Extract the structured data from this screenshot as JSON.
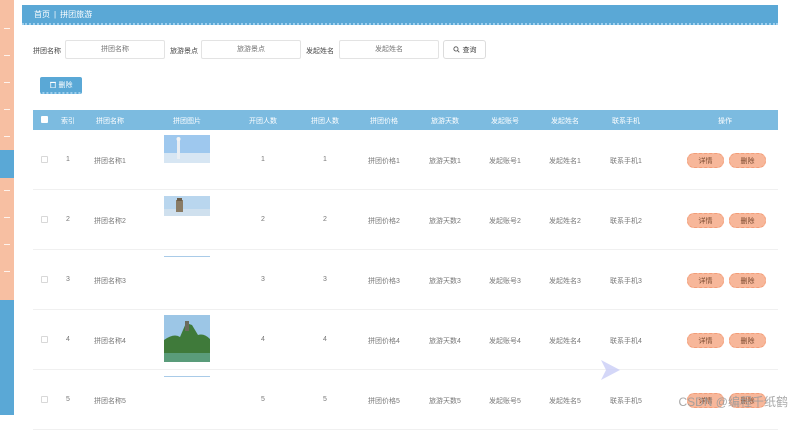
{
  "breadcrumb": {
    "home": "首页",
    "separator": "|",
    "current": "拼团旅游"
  },
  "search": {
    "fields": [
      {
        "label": "拼团名称",
        "placeholder": "拼团名称"
      },
      {
        "label": "旅游景点",
        "placeholder": "旅游景点"
      },
      {
        "label": "发起姓名",
        "placeholder": "发起姓名"
      }
    ],
    "button_label": "查询",
    "button_icon": "search-icon"
  },
  "toolbar": {
    "delete_label": "删除",
    "delete_icon": "trash-icon"
  },
  "table": {
    "columns": [
      "索引",
      "拼团名称",
      "拼团图片",
      "开团人数",
      "拼团人数",
      "拼团价格",
      "旅游天数",
      "发起账号",
      "发起姓名",
      "联系手机",
      "操作"
    ],
    "rows": [
      {
        "index": "1",
        "name": "拼团名称1",
        "open": "1",
        "join": "1",
        "price": "拼团价格1",
        "days": "旅游天数1",
        "account": "发起账号1",
        "person": "发起姓名1",
        "phone": "联系手机1"
      },
      {
        "index": "2",
        "name": "拼团名称2",
        "open": "2",
        "join": "2",
        "price": "拼团价格2",
        "days": "旅游天数2",
        "account": "发起账号2",
        "person": "发起姓名2",
        "phone": "联系手机2"
      },
      {
        "index": "3",
        "name": "拼团名称3",
        "open": "3",
        "join": "3",
        "price": "拼团价格3",
        "days": "旅游天数3",
        "account": "发起账号3",
        "person": "发起姓名3",
        "phone": "联系手机3"
      },
      {
        "index": "4",
        "name": "拼团名称4",
        "open": "4",
        "join": "4",
        "price": "拼团价格4",
        "days": "旅游天数4",
        "account": "发起账号4",
        "person": "发起姓名4",
        "phone": "联系手机4"
      },
      {
        "index": "5",
        "name": "拼团名称5",
        "open": "5",
        "join": "5",
        "price": "拼团价格5",
        "days": "旅游天数5",
        "account": "发起账号5",
        "person": "发起姓名5",
        "phone": "联系手机5"
      }
    ],
    "actions": {
      "detail_label": "详情",
      "delete_label": "删除"
    }
  },
  "watermark": "CSDN @编程千纸鹤",
  "colors": {
    "primary": "#5aa8d6",
    "header": "#7cbbe0",
    "accent": "#f7b79a",
    "sidebar": "#f7bfa2"
  }
}
